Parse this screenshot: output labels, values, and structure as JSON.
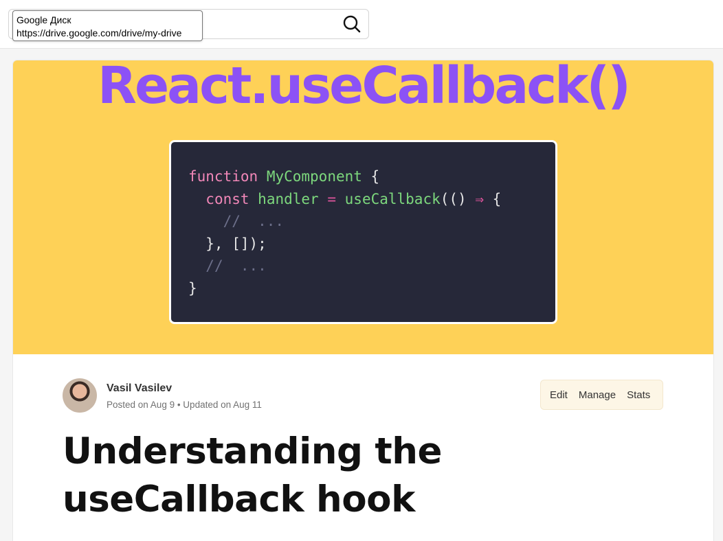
{
  "search": {
    "tooltip_title": "Google Диск",
    "tooltip_url": "https://drive.google.com/drive/my-drive",
    "icon": "search-icon"
  },
  "cover": {
    "title": "React.useCallback()",
    "code_lines": [
      "function MyComponent {",
      "  const handler = useCallback(() ⇒ {",
      "    //  ...",
      "  }, []);",
      "  //  ...",
      "}"
    ]
  },
  "author": {
    "name": "Vasil Vasilev",
    "meta": "Posted on Aug 9 • Updated on Aug 11"
  },
  "actions": {
    "edit": "Edit",
    "manage": "Manage",
    "stats": "Stats"
  },
  "post": {
    "title": "Understanding the useCallback hook"
  },
  "colors": {
    "cover_bg": "#fed157",
    "cover_title": "#8c52f5",
    "code_bg": "#262839"
  }
}
